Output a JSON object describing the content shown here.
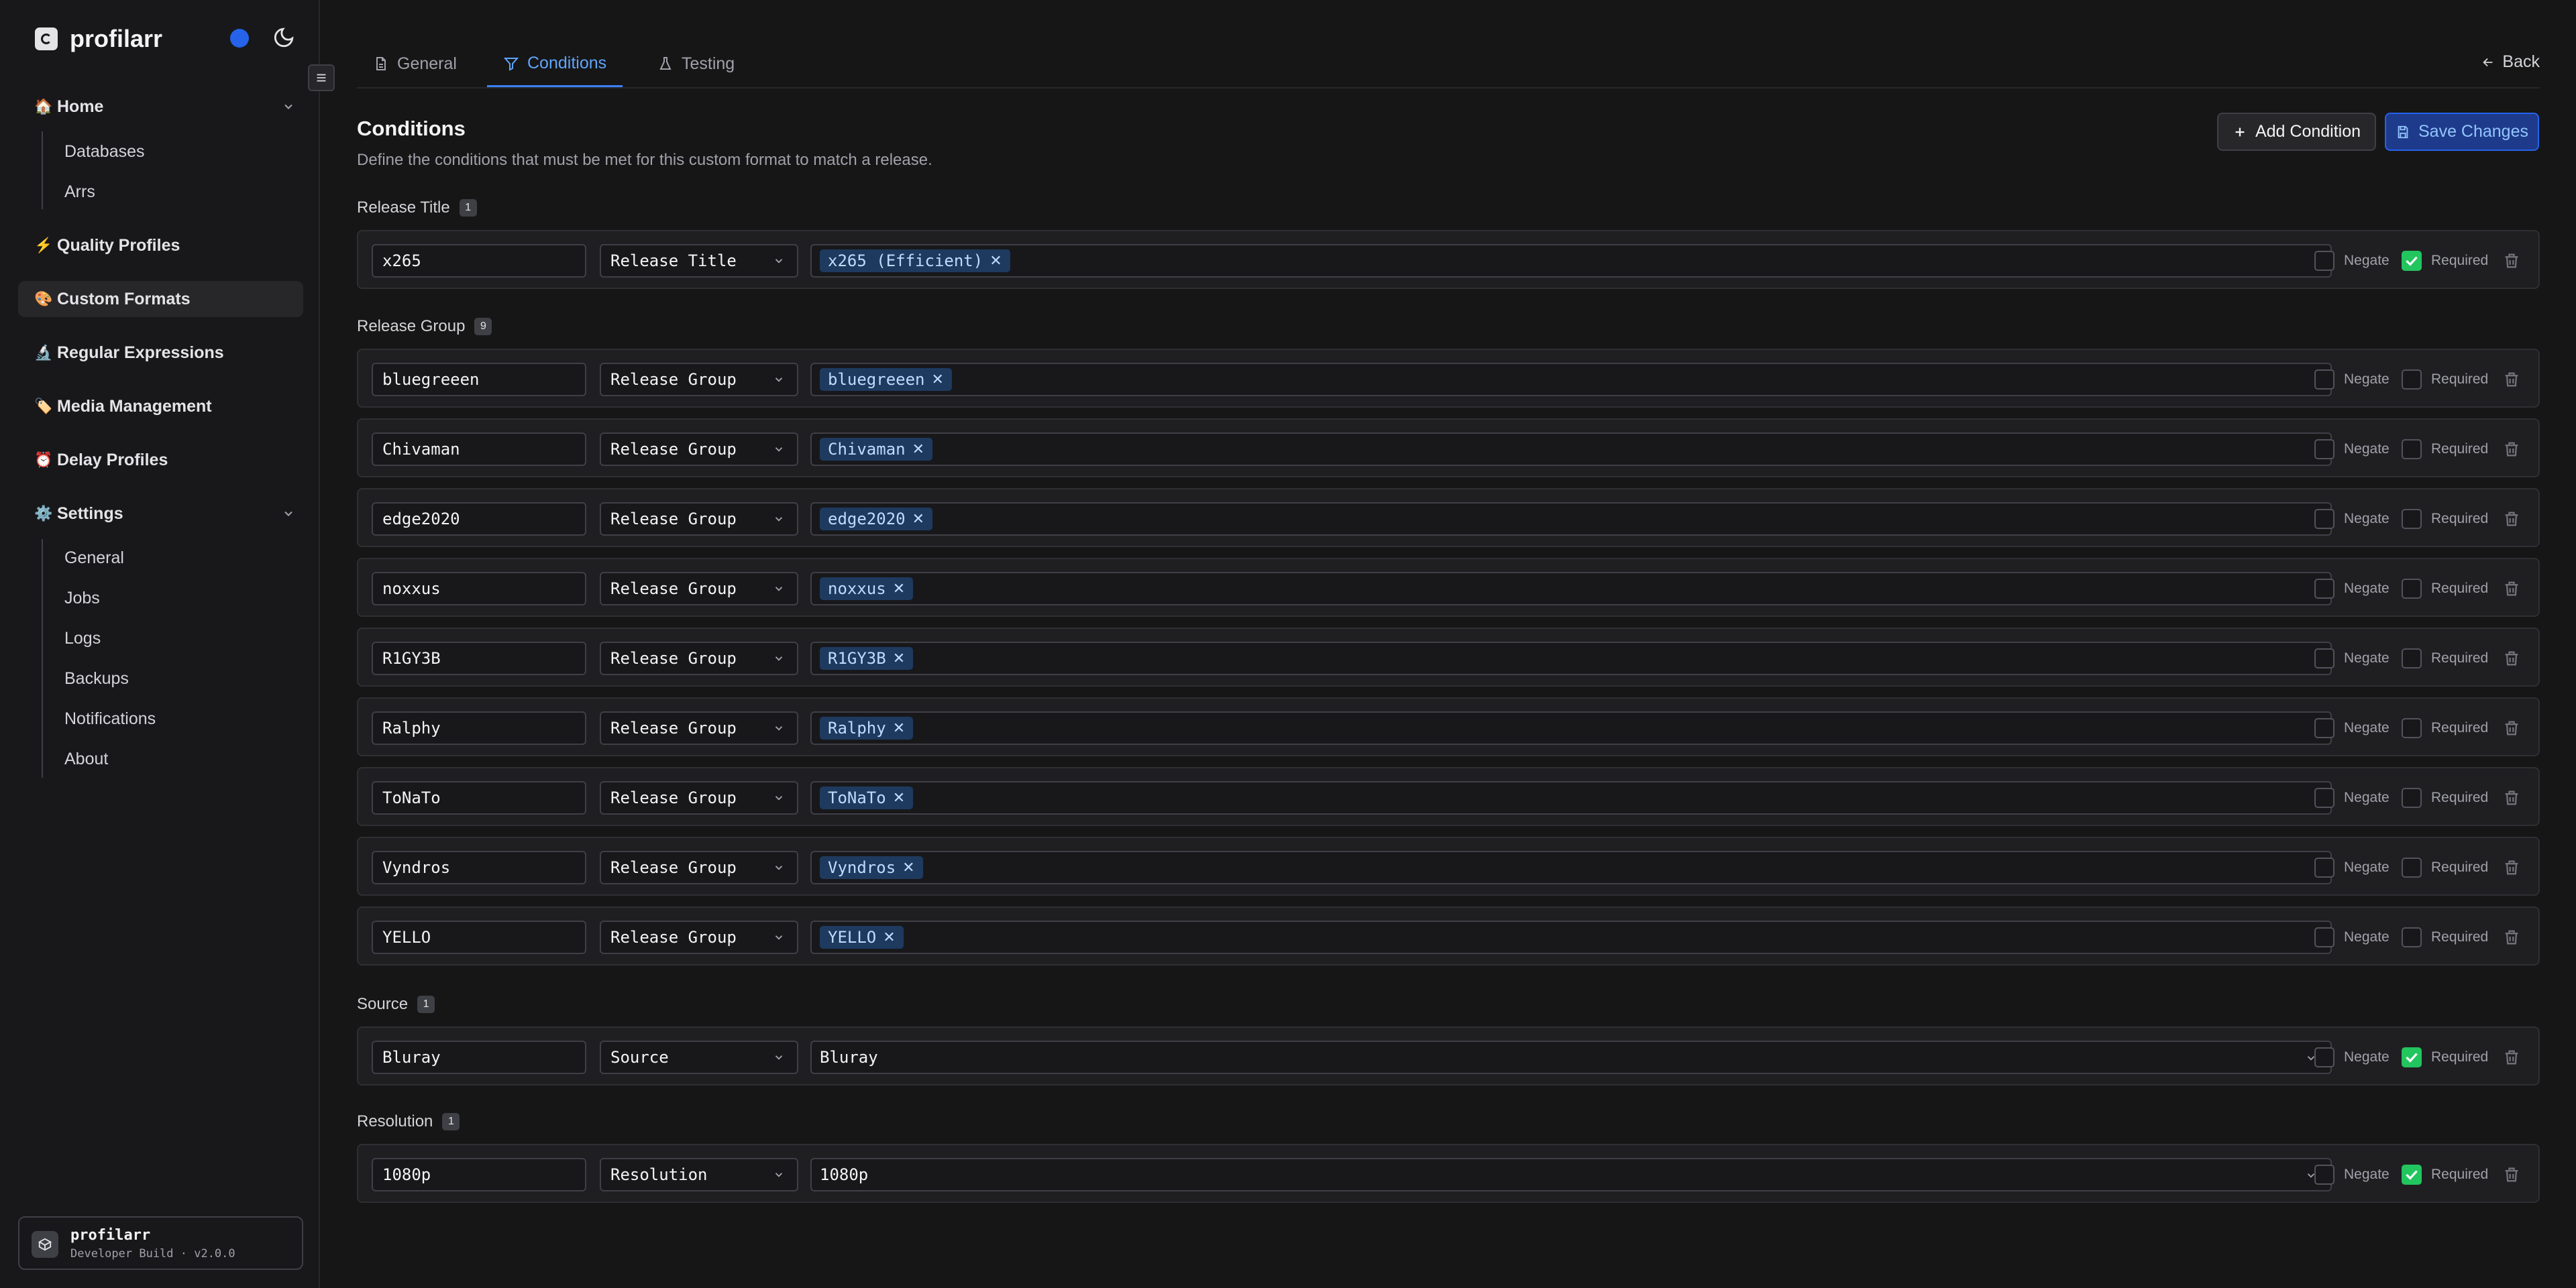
{
  "app": {
    "name": "profilarr"
  },
  "sidebar": {
    "home": {
      "label": "Home",
      "emoji": "🏠",
      "children": [
        "Databases",
        "Arrs"
      ]
    },
    "items": [
      {
        "label": "Quality Profiles",
        "emoji": "⚡"
      },
      {
        "label": "Custom Formats",
        "emoji": "🎨",
        "active": true
      },
      {
        "label": "Regular Expressions",
        "emoji": "🔬"
      },
      {
        "label": "Media Management",
        "emoji": "🏷️"
      },
      {
        "label": "Delay Profiles",
        "emoji": "⏰"
      }
    ],
    "settings": {
      "label": "Settings",
      "emoji": "⚙️",
      "children": [
        "General",
        "Jobs",
        "Logs",
        "Backups",
        "Notifications",
        "About"
      ]
    }
  },
  "footer": {
    "title": "profilarr",
    "subtitle": "Developer Build · v2.0.0"
  },
  "tabs": [
    {
      "label": "General",
      "icon": "document-icon"
    },
    {
      "label": "Conditions",
      "icon": "filter-icon",
      "active": true
    },
    {
      "label": "Testing",
      "icon": "flask-icon"
    }
  ],
  "back_label": "Back",
  "page": {
    "title": "Conditions",
    "description": "Define the conditions that must be met for this custom format to match a release."
  },
  "actions": {
    "add": "Add Condition",
    "save": "Save Changes"
  },
  "labels": {
    "negate": "Negate",
    "required": "Required"
  },
  "sections": [
    {
      "label": "Release Title",
      "count": "1",
      "rows": [
        {
          "name": "x265",
          "type": "Release Title",
          "tag": "x265 (Efficient)",
          "negate": false,
          "required": true
        }
      ]
    },
    {
      "label": "Release Group",
      "count": "9",
      "rows": [
        {
          "name": "bluegreeen",
          "type": "Release Group",
          "tag": "bluegreeen",
          "negate": false,
          "required": false
        },
        {
          "name": "Chivaman",
          "type": "Release Group",
          "tag": "Chivaman",
          "negate": false,
          "required": false
        },
        {
          "name": "edge2020",
          "type": "Release Group",
          "tag": "edge2020",
          "negate": false,
          "required": false
        },
        {
          "name": "noxxus",
          "type": "Release Group",
          "tag": "noxxus",
          "negate": false,
          "required": false
        },
        {
          "name": "R1GY3B",
          "type": "Release Group",
          "tag": "R1GY3B",
          "negate": false,
          "required": false
        },
        {
          "name": "Ralphy",
          "type": "Release Group",
          "tag": "Ralphy",
          "negate": false,
          "required": false
        },
        {
          "name": "ToNaTo",
          "type": "Release Group",
          "tag": "ToNaTo",
          "negate": false,
          "required": false
        },
        {
          "name": "Vyndros",
          "type": "Release Group",
          "tag": "Vyndros",
          "negate": false,
          "required": false
        },
        {
          "name": "YELLO",
          "type": "Release Group",
          "tag": "YELLO",
          "negate": false,
          "required": false
        }
      ]
    },
    {
      "label": "Source",
      "count": "1",
      "rows": [
        {
          "name": "Bluray",
          "type": "Source",
          "select": "Bluray",
          "negate": false,
          "required": true
        }
      ]
    },
    {
      "label": "Resolution",
      "count": "1",
      "rows": [
        {
          "name": "1080p",
          "type": "Resolution",
          "select": "1080p",
          "negate": false,
          "required": true
        }
      ]
    }
  ],
  "colors": {
    "accent": "#3b82f6",
    "checked": "#22c55e",
    "background": "#161617",
    "sidebar": "#18181b"
  }
}
